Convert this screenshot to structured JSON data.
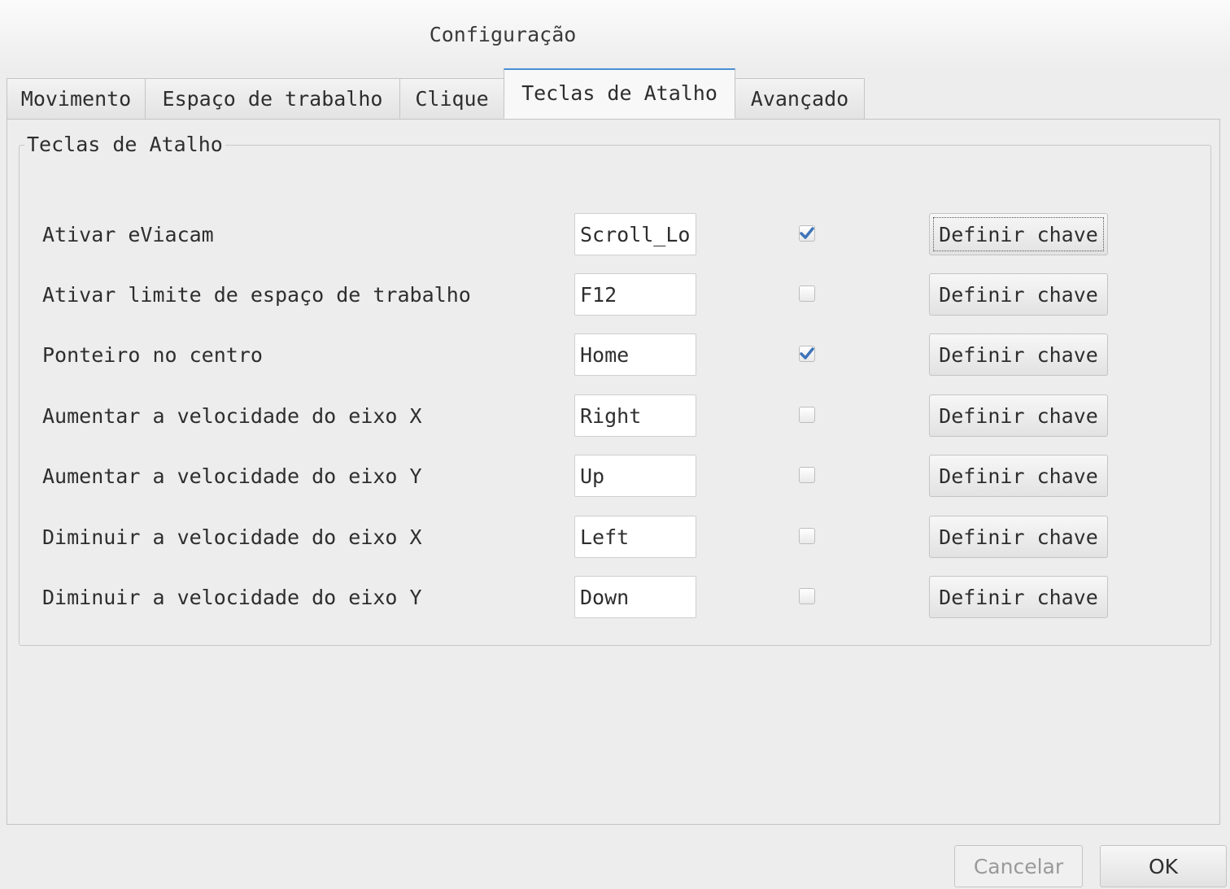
{
  "window": {
    "title": "Configuração"
  },
  "tabs": [
    {
      "label": "Movimento",
      "active": false
    },
    {
      "label": "Espaço de trabalho",
      "active": false
    },
    {
      "label": "Clique",
      "active": false
    },
    {
      "label": "Teclas de Atalho",
      "active": true
    },
    {
      "label": "Avançado",
      "active": false
    }
  ],
  "hotkeys": {
    "group_title": "Teclas de Atalho",
    "rows": [
      {
        "label": "Ativar eViacam",
        "key": "Scroll_Lock",
        "enabled": true,
        "button_label": "Definir chave"
      },
      {
        "label": "Ativar limite de espaço de trabalho",
        "key": "F12",
        "enabled": false,
        "button_label": "Definir chave"
      },
      {
        "label": "Ponteiro no centro",
        "key": "Home",
        "enabled": true,
        "button_label": "Definir chave"
      },
      {
        "label": "Aumentar a velocidade do eixo X",
        "key": "Right",
        "enabled": false,
        "button_label": "Definir chave"
      },
      {
        "label": "Aumentar a velocidade do eixo Y",
        "key": "Up",
        "enabled": false,
        "button_label": "Definir chave"
      },
      {
        "label": "Diminuir a velocidade do eixo X",
        "key": "Left",
        "enabled": false,
        "button_label": "Definir chave"
      },
      {
        "label": "Diminuir a velocidade do eixo Y",
        "key": "Down",
        "enabled": false,
        "button_label": "Definir chave"
      }
    ]
  },
  "footer": {
    "cancel_label": "Cancelar",
    "cancel_enabled": false,
    "ok_label": "OK"
  },
  "colors": {
    "accent": "#4a8fd6",
    "check": "#3f74b8"
  }
}
